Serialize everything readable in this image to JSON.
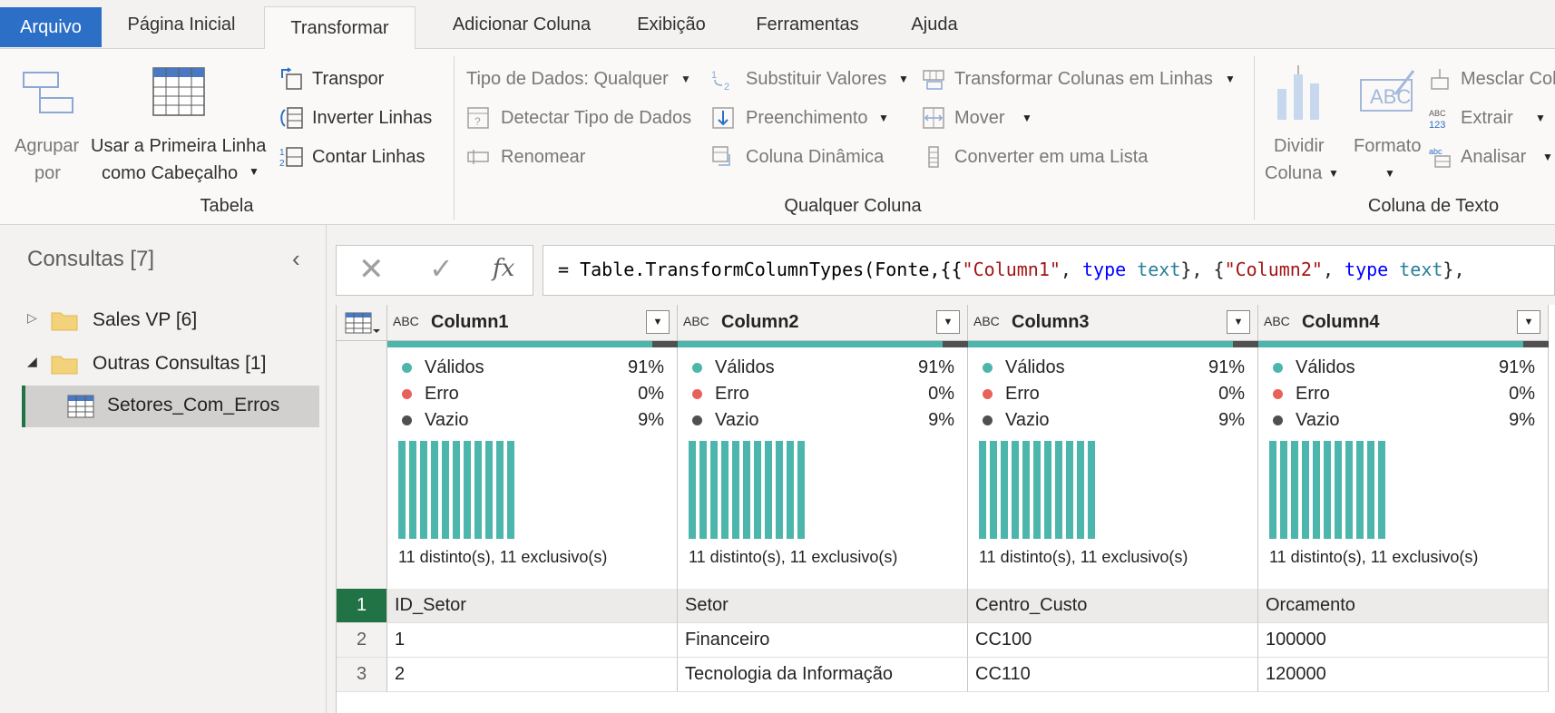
{
  "tabs": [
    {
      "label": "Arquivo"
    },
    {
      "label": "Página Inicial"
    },
    {
      "label": "Transformar"
    },
    {
      "label": "Adicionar Coluna"
    },
    {
      "label": "Exibição"
    },
    {
      "label": "Ferramentas"
    },
    {
      "label": "Ajuda"
    }
  ],
  "ribbon": {
    "tabela": {
      "group_label": "Tabela",
      "agrupar_line1": "Agrupar",
      "agrupar_line2": "por",
      "primeira_line1": "Usar a Primeira Linha",
      "primeira_line2": "como Cabeçalho",
      "transpor": "Transpor",
      "inverter": "Inverter Linhas",
      "contar": "Contar Linhas"
    },
    "qualquer": {
      "group_label": "Qualquer Coluna",
      "tipo_dados": "Tipo de Dados: Qualquer",
      "detectar": "Detectar Tipo de Dados",
      "renomear": "Renomear",
      "substituir": "Substituir Valores",
      "preenchimento": "Preenchimento",
      "dinamica": "Coluna Dinâmica",
      "transformar_linhas": "Transformar Colunas em Linhas",
      "mover": "Mover",
      "converter_lista": "Converter em uma Lista"
    },
    "texto": {
      "group_label": "Coluna de Texto",
      "dividir_line1": "Dividir",
      "dividir_line2": "Coluna",
      "formato": "Formato",
      "mesclar": "Mesclar Col",
      "extrair": "Extrair",
      "analisar": "Analisar"
    }
  },
  "queries": {
    "title": "Consultas [7]",
    "items": [
      {
        "label": "Sales VP [6]"
      },
      {
        "label": "Outras Consultas [1]"
      },
      {
        "label": "Setores_Com_Erros"
      }
    ]
  },
  "formula": {
    "prefix": "= Table.TransformColumnTypes(Fonte,{{",
    "str1": "\"Column1\"",
    "sep1": ", ",
    "kw1": "type",
    "t1": " text",
    "mid": "}, {",
    "str2": "\"Column2\"",
    "sep2": ", ",
    "kw2": "type",
    "t2": " text",
    "tail": "},"
  },
  "columns": [
    {
      "type_icon": "ABC",
      "name": "Column1",
      "valid_label": "Válidos",
      "valid": "91%",
      "error_label": "Erro",
      "error": "0%",
      "empty_label": "Vazio",
      "empty": "9%",
      "distinct": "11 distinto(s), 11 exclusivo(s)"
    },
    {
      "type_icon": "ABC",
      "name": "Column2",
      "valid_label": "Válidos",
      "valid": "91%",
      "error_label": "Erro",
      "error": "0%",
      "empty_label": "Vazio",
      "empty": "9%",
      "distinct": "11 distinto(s), 11 exclusivo(s)"
    },
    {
      "type_icon": "ABC",
      "name": "Column3",
      "valid_label": "Válidos",
      "valid": "91%",
      "error_label": "Erro",
      "error": "0%",
      "empty_label": "Vazio",
      "empty": "9%",
      "distinct": "11 distinto(s), 11 exclusivo(s)"
    },
    {
      "type_icon": "ABC",
      "name": "Column4",
      "valid_label": "Válidos",
      "valid": "91%",
      "error_label": "Erro",
      "error": "0%",
      "empty_label": "Vazio",
      "empty": "9%",
      "distinct": "11 distinto(s), 11 exclusivo(s)"
    }
  ],
  "rows": [
    {
      "num": "1",
      "cells": [
        "ID_Setor",
        "Setor",
        "Centro_Custo",
        "Orcamento"
      ]
    },
    {
      "num": "2",
      "cells": [
        "1",
        "Financeiro",
        "CC100",
        "100000"
      ]
    },
    {
      "num": "3",
      "cells": [
        "2",
        " Tecnologia da Informação",
        "CC110",
        "120000"
      ]
    }
  ],
  "colors": {
    "accent": "#2b6fc7",
    "valid": "#4db6ac",
    "error": "#e8625a",
    "empty": "#505050",
    "selected_query": "#217346"
  }
}
